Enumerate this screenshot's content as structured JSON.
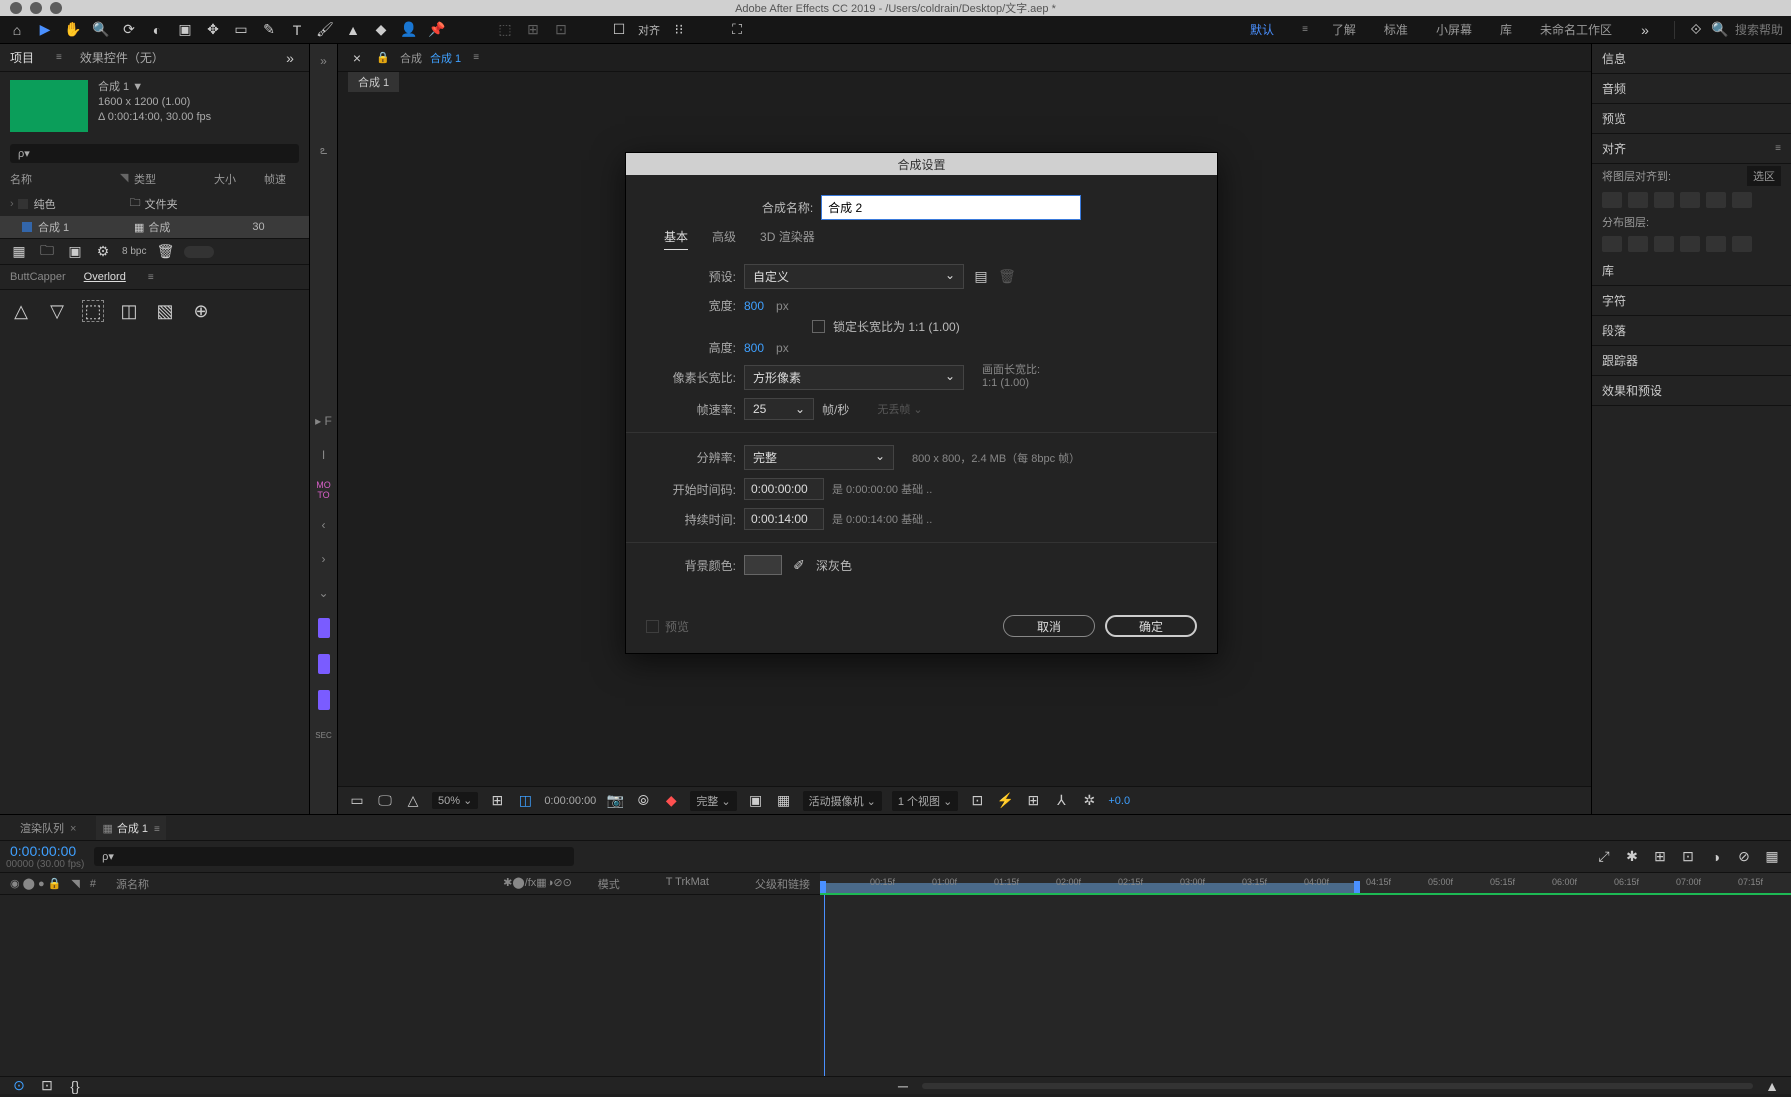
{
  "app": {
    "title": "Adobe After Effects CC 2019 - /Users/coldrain/Desktop/文字.aep *"
  },
  "toolbar": {
    "align_label": "对齐",
    "search_placeholder": "搜索帮助"
  },
  "workspaces": {
    "items": [
      "默认",
      "了解",
      "标准",
      "小屏幕",
      "库",
      "未命名工作区"
    ],
    "active_index": 0
  },
  "project_panel": {
    "tab_project": "项目",
    "tab_effects": "效果控件（无）",
    "comp_name": "合成 1",
    "comp_dims": "1600 x 1200 (1.00)",
    "comp_dur": "Δ 0:00:14:00, 30.00 fps",
    "search_placeholder": "ρ▾",
    "headers": {
      "name": "名称",
      "type": "类型",
      "size": "大小",
      "fps": "帧速"
    },
    "rows": [
      {
        "name": "纯色",
        "type": "文件夹",
        "size": "",
        "fps": "",
        "swatch": "#333",
        "folder": true
      },
      {
        "name": "合成 1",
        "type": "合成",
        "size": "",
        "fps": "30",
        "swatch": "#3366aa",
        "folder": false
      }
    ],
    "bpc": "8 bpc"
  },
  "extension": {
    "tab1": "ButtCapper",
    "tab2": "Overlord"
  },
  "center": {
    "crumb_prefix": "合成",
    "crumb_current": "合成 1",
    "subtab": "合成 1",
    "footer": {
      "zoom": "50%",
      "timecode": "0:00:00:00",
      "resolution": "完整",
      "camera": "活动摄像机",
      "views": "1 个视图",
      "exposure": "+0.0"
    }
  },
  "right_panels": {
    "info": "信息",
    "audio": "音频",
    "preview": "预览",
    "align": "对齐",
    "align_to_label": "将图层对齐到:",
    "align_to_value": "选区",
    "distribute_label": "分布图层:",
    "library": "库",
    "character": "字符",
    "paragraph": "段落",
    "tracker": "跟踪器",
    "effects_presets": "效果和预设"
  },
  "timeline": {
    "tab_render": "渲染队列",
    "tab_comp": "合成 1",
    "current_time": "0:00:00:00",
    "fps_info": "00000 (30.00 fps)",
    "search_placeholder": "ρ▾",
    "col_hash": "#",
    "col_source": "源名称",
    "col_mode": "模式",
    "col_trkmat": "T  TrkMat",
    "col_parent": "父级和链接",
    "ruler_ticks": [
      "00:15f",
      "01:00f",
      "01:15f",
      "02:00f",
      "02:15f",
      "03:00f",
      "03:15f",
      "04:00f",
      "04:15f",
      "05:00f",
      "05:15f",
      "06:00f",
      "06:15f",
      "07:00f",
      "07:15f"
    ]
  },
  "dialog": {
    "title": "合成设置",
    "name_label": "合成名称:",
    "name_value": "合成 2",
    "tab_basic": "基本",
    "tab_advanced": "高级",
    "tab_renderer": "3D 渲染器",
    "preset_label": "预设:",
    "preset_value": "自定义",
    "width_label": "宽度:",
    "width_value": "800",
    "height_label": "高度:",
    "height_value": "800",
    "px": "px",
    "lock_label": "锁定长宽比为 1:1 (1.00)",
    "par_label": "像素长宽比:",
    "par_value": "方形像素",
    "frame_aspect_label": "画面长宽比:",
    "frame_aspect_value": "1:1 (1.00)",
    "fps_label": "帧速率:",
    "fps_value": "25",
    "fps_unit": "帧/秒",
    "fps_drop": "无丢帧",
    "res_label": "分辨率:",
    "res_value": "完整",
    "res_info": "800 x 800，2.4 MB（每 8bpc 帧）",
    "start_label": "开始时间码:",
    "start_value": "0:00:00:00",
    "start_info": "是 0:00:00:00 基础 ..",
    "dur_label": "持续时间:",
    "dur_value": "0:00:14:00",
    "dur_info": "是 0:00:14:00 基础 ..",
    "bg_label": "背景颜色:",
    "bg_name": "深灰色",
    "preview_label": "预览",
    "cancel": "取消",
    "ok": "确定"
  }
}
